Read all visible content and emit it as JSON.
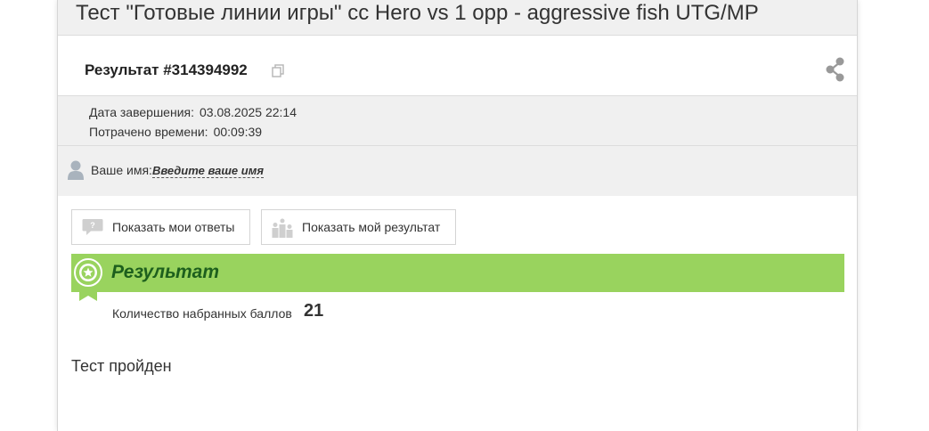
{
  "header": {
    "title": "Тест \"Готовые линии игры\" cc Hero vs 1 opp - aggressive fish UTG/MP"
  },
  "result": {
    "title": "Результат #314394992",
    "copy_icon": "copy-icon",
    "share_icon": "share-icon"
  },
  "meta": {
    "completed_label": "Дата завершения:",
    "completed_value": "03.08.2025 22:14",
    "time_label": "Потрачено времени:",
    "time_value": "00:09:39"
  },
  "user": {
    "icon": "user-icon",
    "name_label": "Ваше имя:",
    "name_link": "Введите ваше имя"
  },
  "buttons": {
    "show_answers": "Показать мои ответы",
    "show_result": "Показать мой результат"
  },
  "result_section": {
    "heading": "Результат",
    "score_label": "Количество набранных баллов",
    "score_value": "21",
    "status": "Тест пройден"
  },
  "colors": {
    "banner": "#99d35e",
    "banner_text": "#1d5f1d",
    "panel_bg": "#f0f0f0"
  }
}
